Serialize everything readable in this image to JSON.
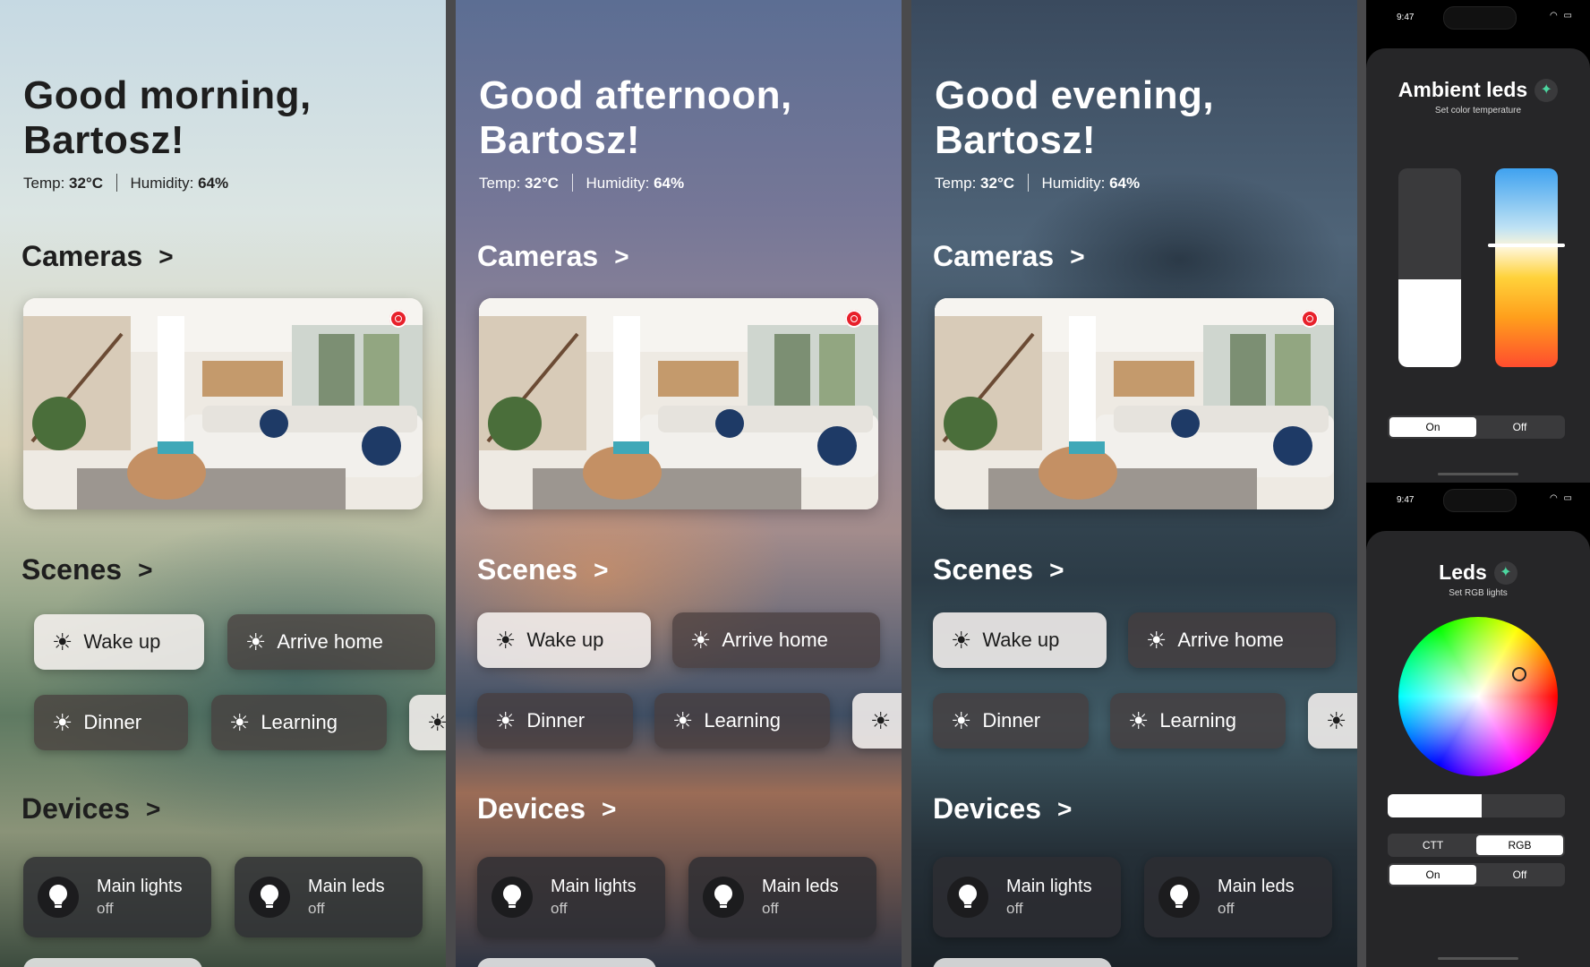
{
  "screens": [
    {
      "greeting_line1": "Good morning,",
      "greeting_line2": "Bartosz!",
      "temp_label": "Temp:",
      "temp_value": "32°C",
      "humidity_label": "Humidity:",
      "humidity_value": "64%",
      "cameras_label": "Cameras",
      "scenes_label": "Scenes",
      "devices_label": "Devices",
      "chevron": ">",
      "scenes": [
        "Wake up",
        "Arrive home",
        "Dinner",
        "Learning"
      ],
      "devices": [
        {
          "name": "Main lights",
          "state": "off"
        },
        {
          "name": "Main leds",
          "state": "off"
        }
      ]
    },
    {
      "greeting_line1": "Good afternoon,",
      "greeting_line2": "Bartosz!",
      "temp_label": "Temp:",
      "temp_value": "32°C",
      "humidity_label": "Humidity:",
      "humidity_value": "64%",
      "cameras_label": "Cameras",
      "scenes_label": "Scenes",
      "devices_label": "Devices",
      "chevron": ">",
      "scenes": [
        "Wake up",
        "Arrive home",
        "Dinner",
        "Learning"
      ],
      "devices": [
        {
          "name": "Main lights",
          "state": "off"
        },
        {
          "name": "Main leds",
          "state": "off"
        }
      ]
    },
    {
      "greeting_line1": "Good evening,",
      "greeting_line2": "Bartosz!",
      "temp_label": "Temp:",
      "temp_value": "32°C",
      "humidity_label": "Humidity:",
      "humidity_value": "64%",
      "cameras_label": "Cameras",
      "scenes_label": "Scenes",
      "devices_label": "Devices",
      "chevron": ">",
      "scenes": [
        "Wake up",
        "Arrive home",
        "Dinner",
        "Learning"
      ],
      "devices": [
        {
          "name": "Main lights",
          "state": "off"
        },
        {
          "name": "Main leds",
          "state": "off"
        }
      ]
    }
  ],
  "phone_ambient": {
    "time": "9:47",
    "title": "Ambient leds",
    "subtitle": "Set color temperature",
    "brightness_level": 0.44,
    "color_temperature_level": 0.62,
    "power_on": "On",
    "power_off": "Off",
    "power_selected": "On"
  },
  "phone_leds": {
    "time": "9:47",
    "title": "Leds",
    "subtitle": "Set RGB lights",
    "brightness_level": 0.53,
    "mode_ctt": "CTT",
    "mode_rgb": "RGB",
    "mode_selected": "RGB",
    "power_on": "On",
    "power_off": "Off",
    "power_selected": "On"
  },
  "colors": {
    "record_indicator": "#e8202b",
    "accent_spark": "#4cd6a0",
    "sheet_bg": "#262628"
  },
  "icons": {
    "scene": "sun-icon",
    "device": "lightbulb-icon",
    "camera_status": "record-icon",
    "title_badge": "sparkle-icon"
  }
}
